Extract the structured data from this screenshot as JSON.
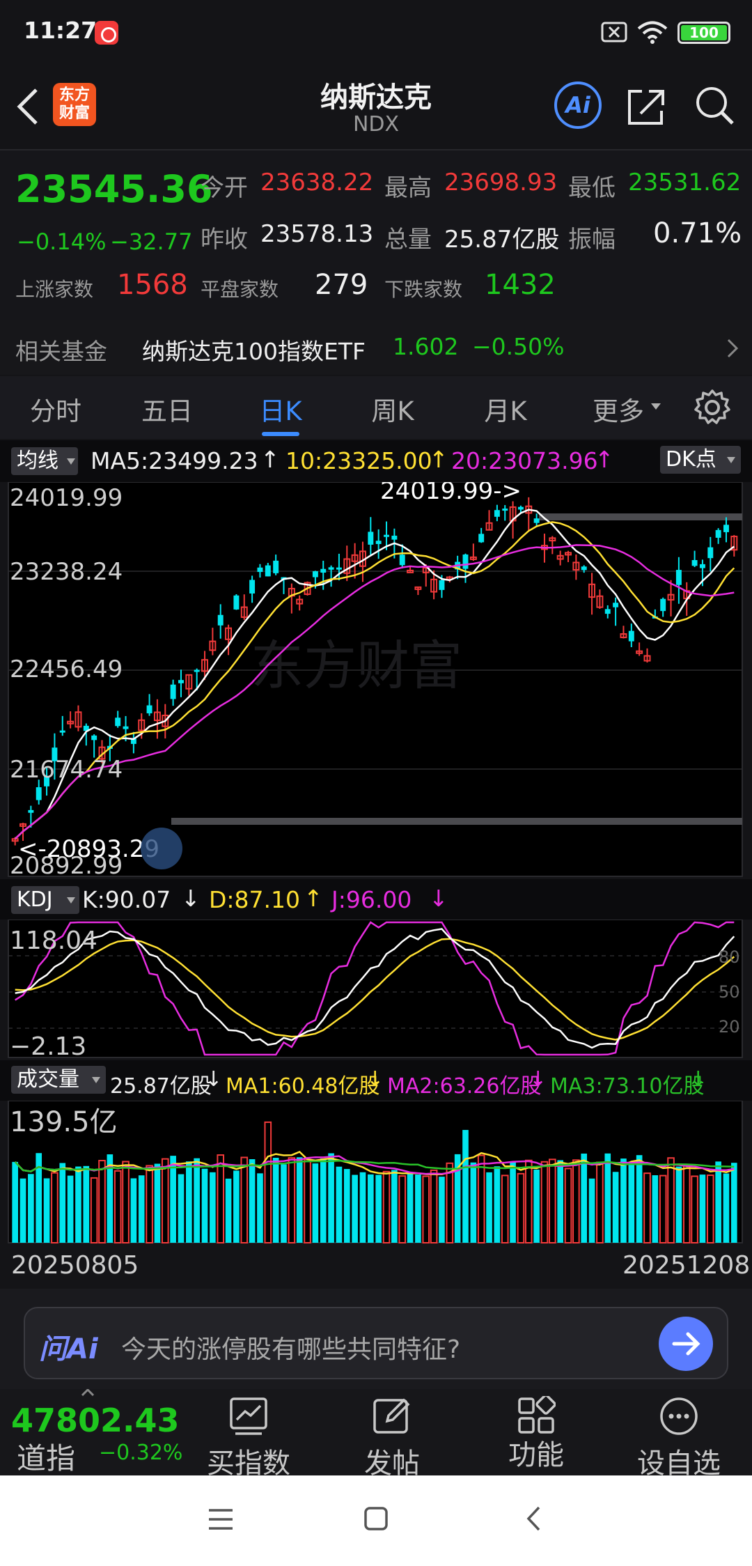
{
  "status_bar": {
    "time": "11:27",
    "battery": "100"
  },
  "header": {
    "title": "纳斯达克",
    "subtitle": "NDX",
    "logo_text": "东方财富",
    "ai_label": "Ai"
  },
  "quote": {
    "price": "23545.36",
    "change_pct": "−0.14%",
    "change_val": "−32.77",
    "open_label": "今开",
    "open": "23638.22",
    "high_label": "最高",
    "high": "23698.93",
    "low_label": "最低",
    "low": "23531.62",
    "prev_close_label": "昨收",
    "prev_close": "23578.13",
    "volume_label": "总量",
    "volume": "25.87亿股",
    "amplitude_label": "振幅",
    "amplitude": "0.71%",
    "up_label": "上涨家数",
    "up": "1568",
    "flat_label": "平盘家数",
    "flat": "279",
    "down_label": "下跌家数",
    "down": "1432"
  },
  "fund": {
    "label": "相关基金",
    "name": "纳斯达克100指数ETF",
    "price": "1.602",
    "change": "−0.50%"
  },
  "tabs": [
    {
      "label": "分时"
    },
    {
      "label": "五日"
    },
    {
      "label": "日K"
    },
    {
      "label": "周K"
    },
    {
      "label": "月K"
    },
    {
      "label": "更多"
    }
  ],
  "ma_legend": {
    "chip": "均线",
    "ma5": "MA5:23499.23",
    "ma10": "10:23325.00",
    "ma20": "20:23073.96",
    "dk": "DK点"
  },
  "kline": {
    "y_labels": [
      "24019.99",
      "23238.24",
      "22456.49",
      "21674.74",
      "20892.99"
    ],
    "max_note": "24019.99->",
    "min_note": "<-20893.29"
  },
  "kdj_legend": {
    "chip": "KDJ",
    "k": "K:90.07",
    "d": "D:87.10",
    "j": "J:96.00"
  },
  "kdj_axis": {
    "top": "118.04",
    "bottom": "−2.13",
    "l80": "80",
    "l50": "50",
    "l20": "20"
  },
  "vol_legend": {
    "chip": "成交量",
    "vol": "25.87亿股",
    "ma1": "MA1:60.48亿股",
    "ma2": "MA2:63.26亿股",
    "ma3": "MA3:73.10亿股"
  },
  "vol_axis": {
    "top": "139.5亿"
  },
  "date_range": {
    "start": "20250805",
    "end": "20251208"
  },
  "ask_ai": {
    "brand": "问Ai",
    "placeholder": "今天的涨停股有哪些共同特征?"
  },
  "bottom_nav": {
    "index_value": "47802.43",
    "index_name": "道指",
    "index_change": "−0.32%",
    "items": [
      {
        "label": "买指数"
      },
      {
        "label": "发帖"
      },
      {
        "label": "功能"
      },
      {
        "label": "设自选"
      }
    ]
  },
  "colors": {
    "up": "#f23a3a",
    "down": "#1ec81e",
    "ma5": "#ffffff",
    "ma10": "#ffe033",
    "ma20": "#e72de0",
    "accent": "#3c8cff",
    "cyan": "#00e5ee"
  }
}
